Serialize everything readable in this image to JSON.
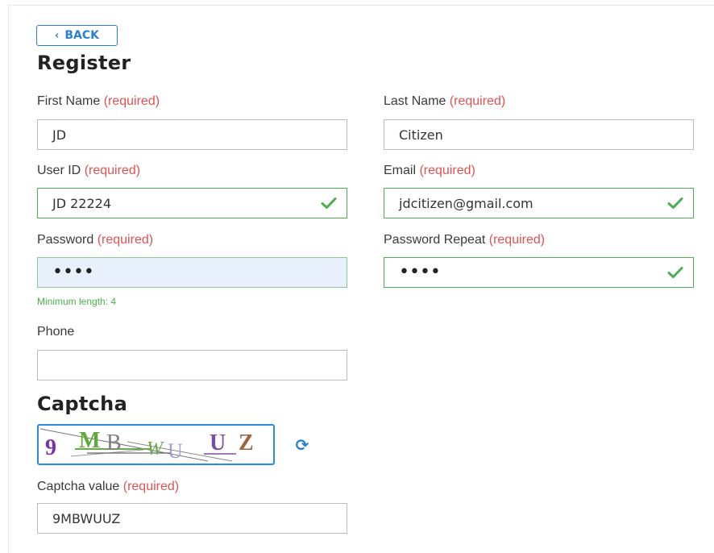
{
  "back_button": {
    "label": "BACK",
    "icon": "chevron-left-icon"
  },
  "register": {
    "title": "Register",
    "required_text": "(required)",
    "first_name": {
      "label": "First Name",
      "value": "JD"
    },
    "last_name": {
      "label": "Last Name",
      "value": "Citizen"
    },
    "user_id": {
      "label": "User ID",
      "value": "JD 22224",
      "valid": true
    },
    "email": {
      "label": "Email",
      "value": "jdcitizen@gmail.com",
      "valid": true
    },
    "password": {
      "label": "Password",
      "masked_value": "••••",
      "hint": "Minimum length: 4"
    },
    "password_repeat": {
      "label": "Password Repeat",
      "masked_value": "••••",
      "valid": true
    },
    "phone": {
      "label": "Phone",
      "value": ""
    }
  },
  "captcha": {
    "title": "Captcha",
    "image_text": "9MBWUUZ",
    "value_label": "Captcha value",
    "value": "9MBWUUZ",
    "refresh_icon": "refresh-icon"
  },
  "colors": {
    "accent": "#2a7fd4",
    "required": "#e05252",
    "valid": "#4caf50",
    "focus_bg": "#e8f0fb"
  }
}
